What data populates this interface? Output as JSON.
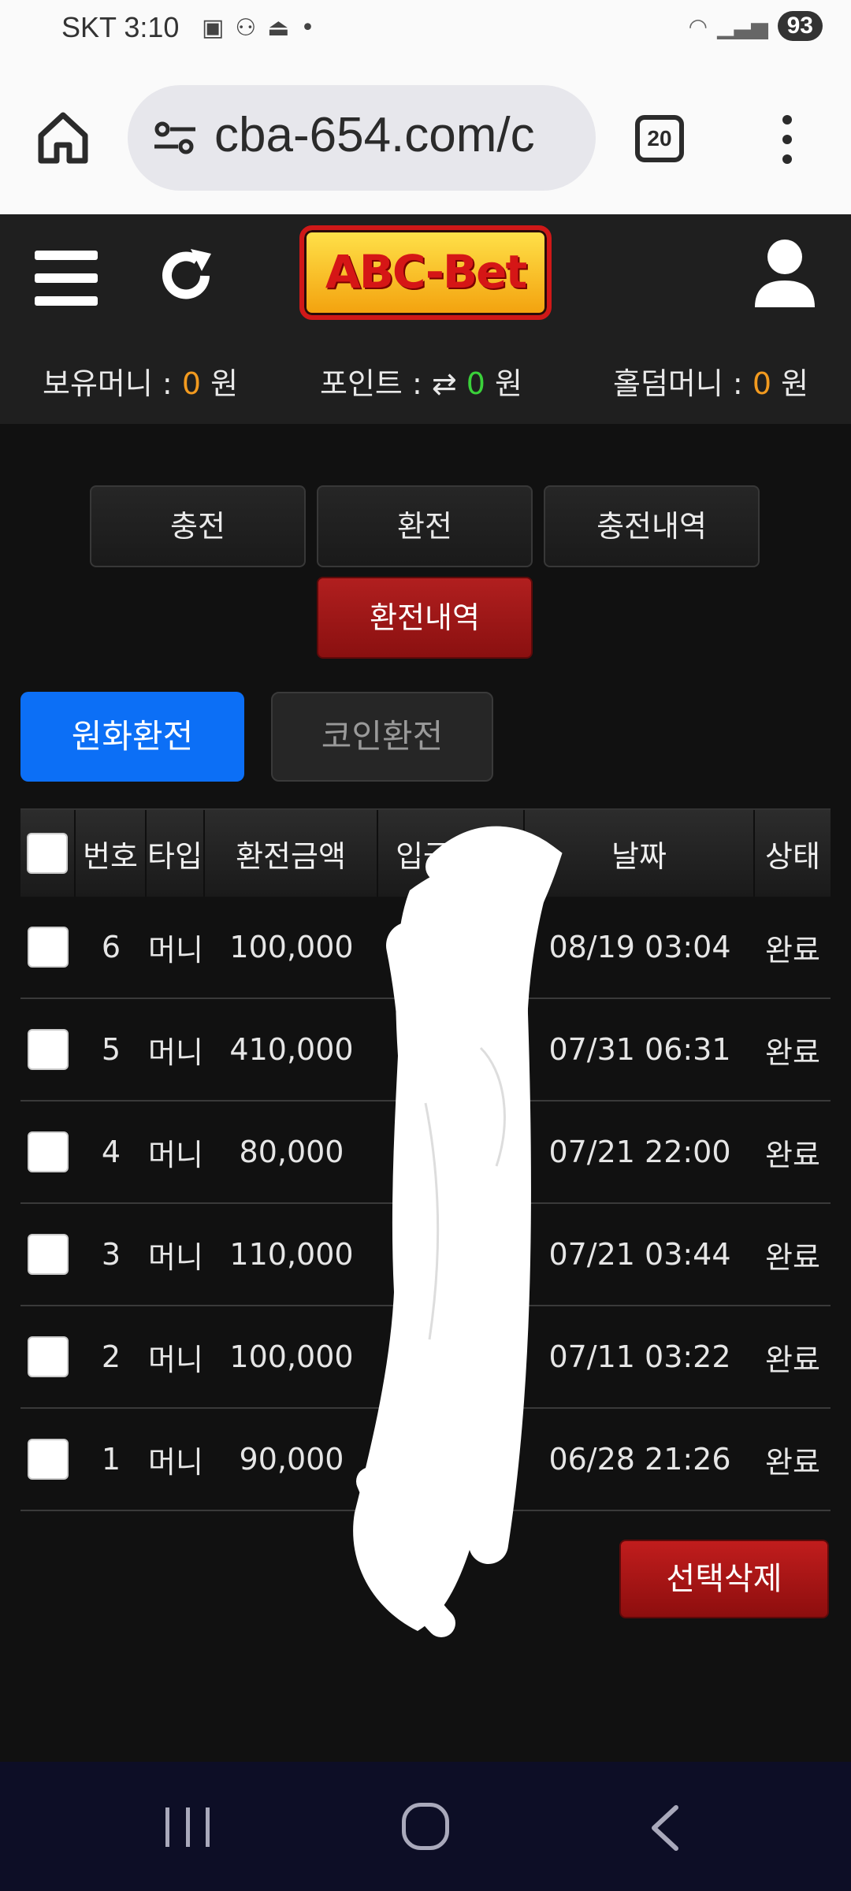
{
  "status_bar": {
    "carrier_time": "SKT 3:10",
    "battery": "93"
  },
  "browser": {
    "url": "cba-654.com/c",
    "tab_count": "20"
  },
  "header": {
    "logo": "ABC-Bet",
    "balance_label": "보유머니 : ",
    "balance_value": "0",
    "balance_unit": " 원",
    "point_label": "포인트 : ",
    "point_value": "0",
    "point_unit": " 원",
    "holdem_label": "홀덤머니 : ",
    "holdem_value": "0",
    "holdem_unit": " 원"
  },
  "menu": {
    "charge": "충전",
    "exchange": "환전",
    "charge_history": "충전내역",
    "exchange_history": "환전내역"
  },
  "tabs": {
    "won": "원화환전",
    "coin": "코인환전"
  },
  "table": {
    "headers": [
      "번호",
      "타입",
      "환전금액",
      "입금자명",
      "날짜",
      "상태"
    ],
    "rows": [
      {
        "no": "6",
        "type": "머니",
        "amount": "100,000",
        "date": "08/19 03:04",
        "status": "완료"
      },
      {
        "no": "5",
        "type": "머니",
        "amount": "410,000",
        "date": "07/31 06:31",
        "status": "완료"
      },
      {
        "no": "4",
        "type": "머니",
        "amount": "80,000",
        "date": "07/21 22:00",
        "status": "완료"
      },
      {
        "no": "3",
        "type": "머니",
        "amount": "110,000",
        "date": "07/21 03:44",
        "status": "완료"
      },
      {
        "no": "2",
        "type": "머니",
        "amount": "100,000",
        "date": "07/11 03:22",
        "status": "완료"
      },
      {
        "no": "1",
        "type": "머니",
        "amount": "90,000",
        "date": "06/28 21:26",
        "status": "완료"
      }
    ]
  },
  "actions": {
    "delete_selected": "선택삭제"
  },
  "colors": {
    "accent_blue": "#0c6ff6",
    "accent_red": "#a51818",
    "value_orange": "#f29a1f",
    "value_green": "#3ad13a"
  }
}
